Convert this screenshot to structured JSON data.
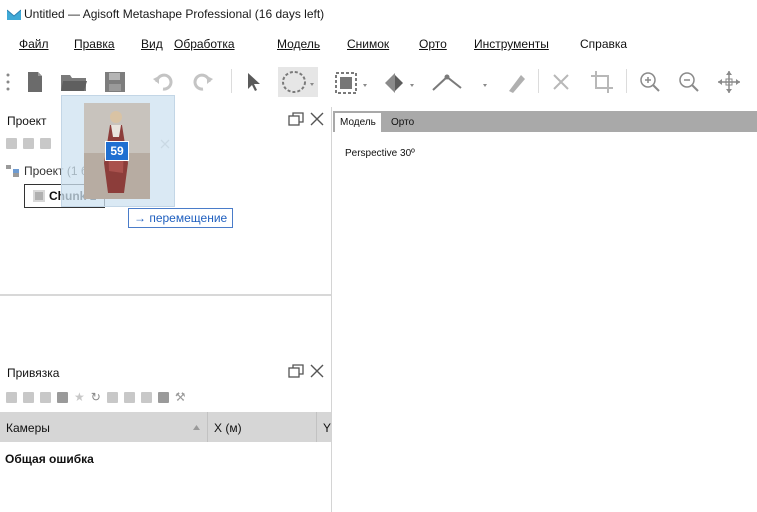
{
  "window": {
    "title": "Untitled — Agisoft Metashape Professional (16 days left)"
  },
  "menu": {
    "items": [
      "Файл",
      "Правка",
      "Вид",
      "Обработка",
      "Модель",
      "Снимок",
      "Орто",
      "Инструменты",
      "Справка"
    ]
  },
  "toolbar": {
    "icons": [
      "new-document-icon",
      "open-folder-icon",
      "save-icon",
      "undo-icon",
      "redo-icon",
      "pointer-icon",
      "ellipse-select-icon",
      "rectangle-select-icon",
      "navigation-icon",
      "ruler-line-icon",
      "eraser-icon",
      "delete-icon",
      "crop-icon",
      "zoom-in-icon",
      "zoom-out-icon",
      "move-icon"
    ]
  },
  "project_panel": {
    "title": "Проект",
    "tree": {
      "root_label": "Проект (1 блок)",
      "chunk_label": "Chunk 1"
    }
  },
  "drag_overlay": {
    "count": "59",
    "move_label": "→ перемещение"
  },
  "reference_panel": {
    "title": "Привязка",
    "columns": [
      "Камеры",
      "X (м)",
      "Y"
    ],
    "summary_label": "Общая ошибка"
  },
  "view": {
    "tabs": [
      "Модель",
      "Орто"
    ],
    "perspective_label": "Perspective 30º"
  },
  "colors": {
    "accent": "#1a73e8",
    "badge": "#1f6fd1",
    "tabstrip": "#a9a9a9"
  }
}
